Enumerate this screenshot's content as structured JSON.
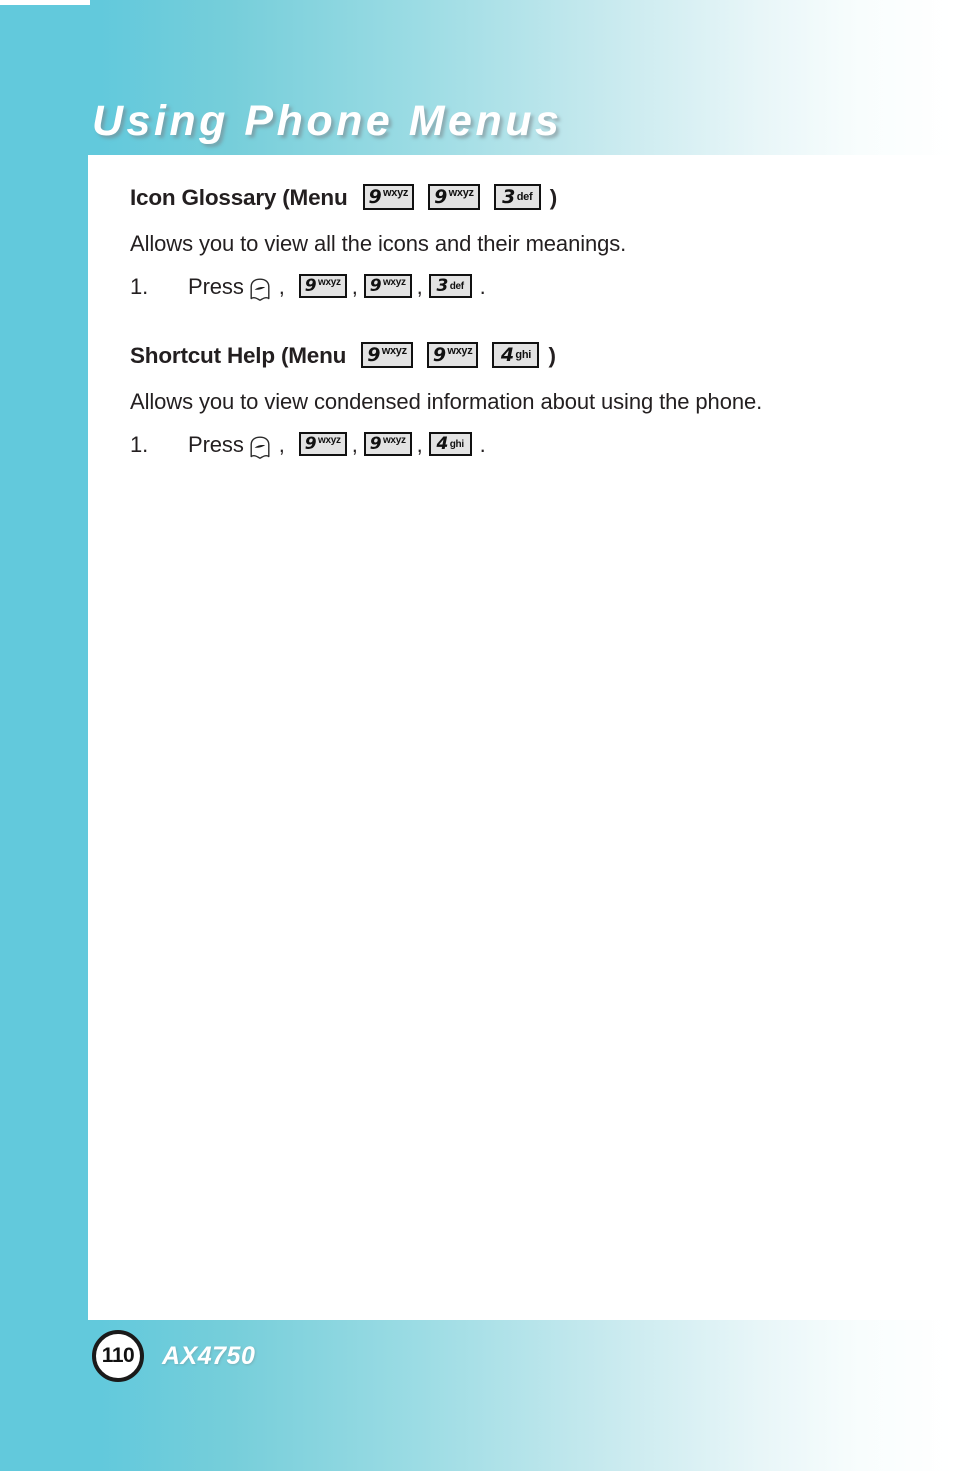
{
  "page": {
    "title": "Using Phone Menus",
    "number": "110",
    "model": "AX4750"
  },
  "keys": {
    "menu_icon": "menu-softkey-icon",
    "nine": {
      "digit": "9",
      "letters": "wxyz"
    },
    "three": {
      "digit": "3",
      "letters": "def"
    },
    "four": {
      "digit": "4",
      "letters": "ghi"
    }
  },
  "sections": [
    {
      "heading": "Icon Glossary (Menu",
      "heading_close": ")",
      "description": "Allows you to view all the icons and their meanings.",
      "step_number": "1.",
      "step_label": "Press",
      "step_end": ".",
      "comma": ",",
      "heading_keys": [
        {
          "digit": "9",
          "letters": "wxyz"
        },
        {
          "digit": "9",
          "letters": "wxyz"
        },
        {
          "digit": "3",
          "letters": "def"
        }
      ],
      "step_keys": [
        {
          "digit": "9",
          "letters": "wxyz"
        },
        {
          "digit": "9",
          "letters": "wxyz"
        },
        {
          "digit": "3",
          "letters": "def"
        }
      ]
    },
    {
      "heading": "Shortcut Help (Menu",
      "heading_close": ")",
      "description": "Allows you to view condensed information about using the phone.",
      "step_number": "1.",
      "step_label": "Press",
      "step_end": ".",
      "comma": ",",
      "heading_keys": [
        {
          "digit": "9",
          "letters": "wxyz"
        },
        {
          "digit": "9",
          "letters": "wxyz"
        },
        {
          "digit": "4",
          "letters": "ghi"
        }
      ],
      "step_keys": [
        {
          "digit": "9",
          "letters": "wxyz"
        },
        {
          "digit": "9",
          "letters": "wxyz"
        },
        {
          "digit": "4",
          "letters": "ghi"
        }
      ]
    }
  ],
  "colors": {
    "banner_start": "#62c9dc",
    "banner_end": "#ffffff",
    "text": "#231f20",
    "key_fill": "#e3e3e3",
    "key_border": "#111111"
  }
}
